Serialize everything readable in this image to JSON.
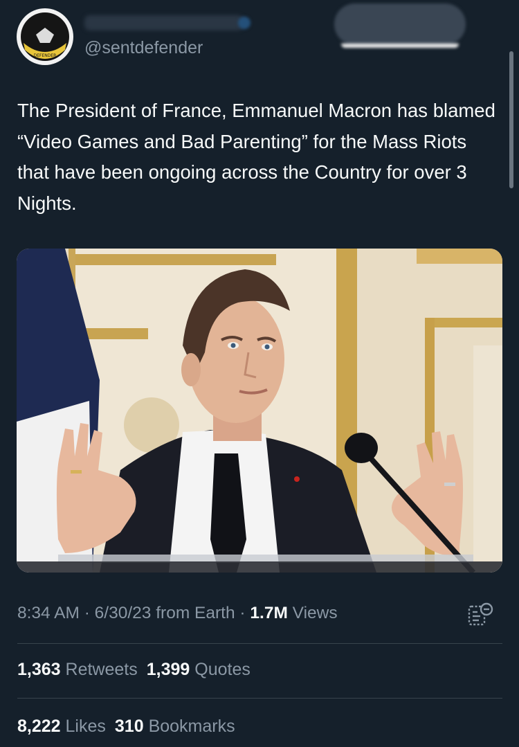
{
  "author": {
    "handle": "@sentdefender",
    "avatar_icon": "shield-logo-icon"
  },
  "tweet": {
    "text": "The President of France, Emmanuel Macron has blamed “Video Games and Bad Parenting” for the Mass Riots that have been ongoing across the Country for over 3 Nights."
  },
  "meta": {
    "time": "8:34 AM",
    "sep1": " · ",
    "date": "6/30/23",
    "source": " from Earth",
    "sep2": " · ",
    "views_count": "1.7M",
    "views_label": " Views"
  },
  "stats": {
    "retweets_count": "1,363",
    "retweets_label": "Retweets",
    "quotes_count": "1,399",
    "quotes_label": "Quotes",
    "likes_count": "8,222",
    "likes_label": "Likes",
    "bookmarks_count": "310",
    "bookmarks_label": "Bookmarks"
  },
  "colors": {
    "background": "#15202b",
    "text_primary": "#f7f9f9",
    "text_secondary": "#8b98a5",
    "divider": "#38444d"
  }
}
